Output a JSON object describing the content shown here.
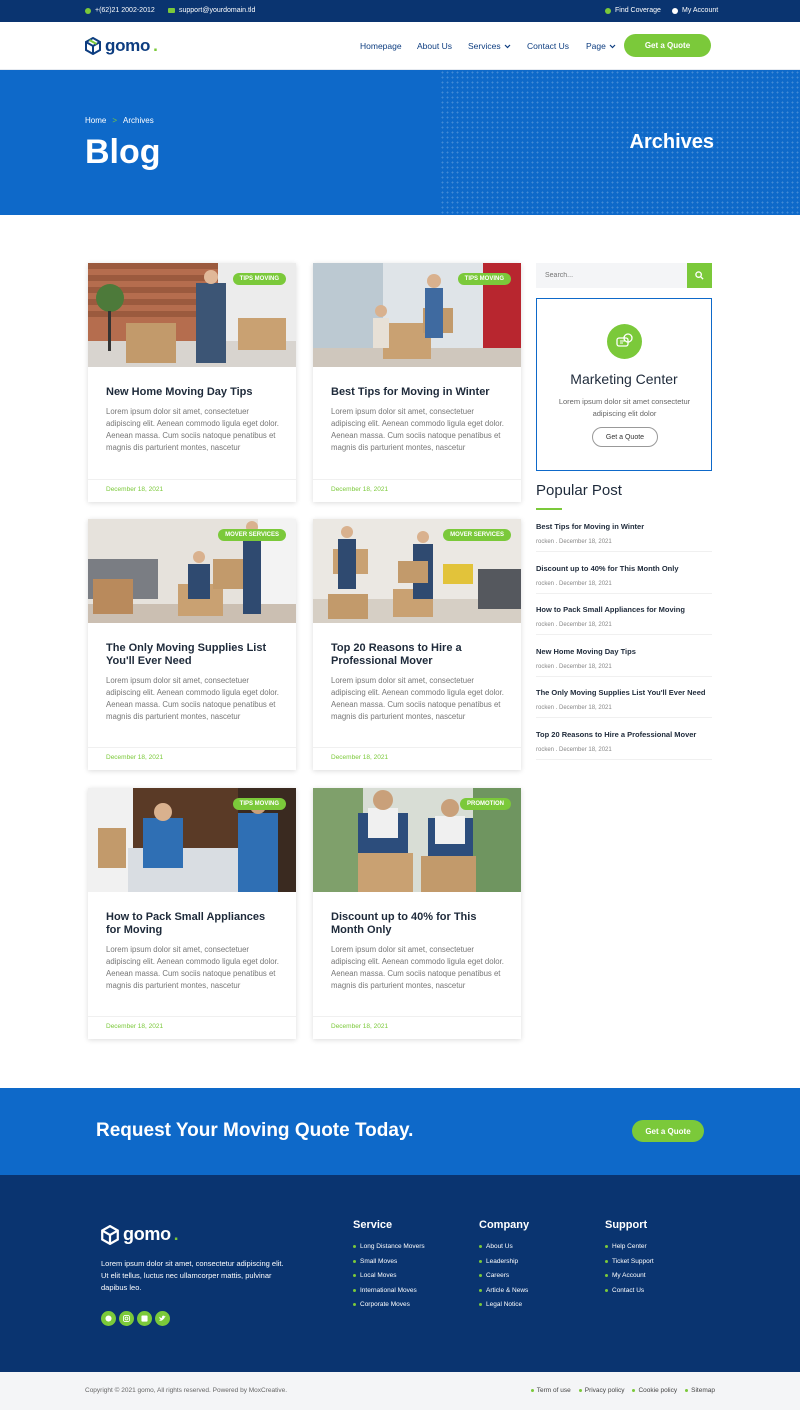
{
  "topbar": {
    "phone": "+(62)21 2002-2012",
    "email": "support@yourdomain.tld",
    "coverage": "Find Coverage",
    "account": "My Account"
  },
  "header": {
    "logo": "gomo",
    "nav": [
      "Homepage",
      "About Us",
      "Services",
      "Contact Us",
      "Page"
    ],
    "quote_button": "Get a Quote"
  },
  "hero": {
    "breadcrumb_home": "Home",
    "breadcrumb_current": "Archives",
    "title": "Blog",
    "right_title": "Archives"
  },
  "posts": [
    {
      "category": "TIPS MOVING",
      "title": "New Home Moving Day Tips",
      "excerpt": "Lorem ipsum dolor sit amet, consectetuer adipiscing elit. Aenean commodo ligula eget dolor. Aenean massa. Cum sociis natoque penatibus et magnis dis parturient montes, nascetur",
      "date": "December 18, 2021"
    },
    {
      "category": "TIPS MOVING",
      "title": "Best Tips for Moving in Winter",
      "excerpt": "Lorem ipsum dolor sit amet, consectetuer adipiscing elit. Aenean commodo ligula eget dolor. Aenean massa. Cum sociis natoque penatibus et magnis dis parturient montes, nascetur",
      "date": "December 18, 2021"
    },
    {
      "category": "MOVER SERVICES",
      "title": "The Only Moving Supplies List You'll Ever Need",
      "excerpt": "Lorem ipsum dolor sit amet, consectetuer adipiscing elit. Aenean commodo ligula eget dolor. Aenean massa. Cum sociis natoque penatibus et magnis dis parturient montes, nascetur",
      "date": "December 18, 2021"
    },
    {
      "category": "MOVER SERVICES",
      "title": "Top 20 Reasons to Hire a Professional Mover",
      "excerpt": "Lorem ipsum dolor sit amet, consectetuer adipiscing elit. Aenean commodo ligula eget dolor. Aenean massa. Cum sociis natoque penatibus et magnis dis parturient montes, nascetur",
      "date": "December 18, 2021"
    },
    {
      "category": "TIPS MOVING",
      "title": "How to Pack Small Appliances for Moving",
      "excerpt": "Lorem ipsum dolor sit amet, consectetuer adipiscing elit. Aenean commodo ligula eget dolor. Aenean massa. Cum sociis natoque penatibus et magnis dis parturient montes, nascetur",
      "date": "December 18, 2021"
    },
    {
      "category": "PROMOTION",
      "title": "Discount up to 40% for This Month Only",
      "excerpt": "Lorem ipsum dolor sit amet, consectetuer adipiscing elit. Aenean commodo ligula eget dolor. Aenean massa. Cum sociis natoque penatibus et magnis dis parturient montes, nascetur",
      "date": "December 18, 2021"
    }
  ],
  "sidebar": {
    "search_placeholder": "Search...",
    "marketing": {
      "title": "Marketing Center",
      "text": "Lorem ipsum dolor sit amet consectetur adipiscing elit dolor",
      "button": "Get a Quote"
    },
    "popular_title": "Popular Post",
    "popular": [
      {
        "title": "Best Tips for Moving in Winter",
        "meta": "rocken . December 18, 2021"
      },
      {
        "title": "Discount up to 40% for This Month Only",
        "meta": "rocken . December 18, 2021"
      },
      {
        "title": "How to Pack Small Appliances for Moving",
        "meta": "rocken . December 18, 2021"
      },
      {
        "title": "New Home Moving Day Tips",
        "meta": "rocken . December 18, 2021"
      },
      {
        "title": "The Only Moving Supplies List You'll Ever Need",
        "meta": "rocken . December 18, 2021"
      },
      {
        "title": "Top 20 Reasons to Hire a Professional Mover",
        "meta": "rocken . December 18, 2021"
      }
    ]
  },
  "cta": {
    "text": "Request Your Moving Quote Today.",
    "button": "Get a Quote"
  },
  "footer": {
    "logo": "gomo",
    "about": "Lorem ipsum dolor sit amet, consectetur adipiscing elit. Ut elit tellus, luctus nec ullamcorper mattis, pulvinar dapibus leo.",
    "service_title": "Service",
    "service": [
      "Long Distance Movers",
      "Small Moves",
      "Local Moves",
      "International Moves",
      "Corporate Moves"
    ],
    "company_title": "Company",
    "company": [
      "About Us",
      "Leadership",
      "Careers",
      "Article & News",
      "Legal Notice"
    ],
    "support_title": "Support",
    "support": [
      "Help Center",
      "Ticket Support",
      "My Account",
      "Contact Us"
    ],
    "copyright": "Copyright © 2021 gomo, All rights reserved. Powered by MoxCreative.",
    "bottom_links": [
      "Term of use",
      "Privacy policy",
      "Cookie policy",
      "Sitemap"
    ]
  },
  "colors": {
    "primary": "#0e69c9",
    "dark": "#0a3470",
    "accent": "#7bc93a"
  }
}
